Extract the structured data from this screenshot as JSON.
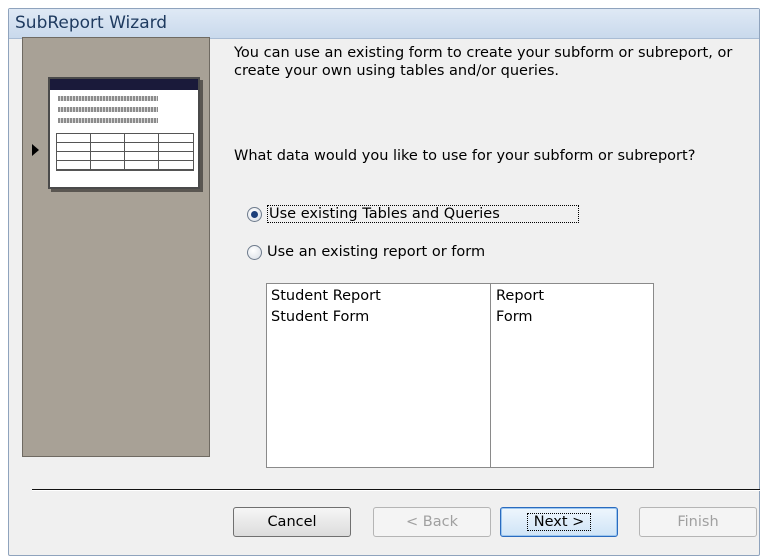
{
  "window": {
    "title": "SubReport Wizard"
  },
  "content": {
    "intro": "You can use an existing form to create your subform or subreport, or create your own using tables and/or queries.",
    "question": "What data would you like to use for your subform or subreport?",
    "options": [
      {
        "label": "Use existing Tables and Queries",
        "checked": true
      },
      {
        "label": "Use an existing report or form",
        "checked": false
      }
    ],
    "list": [
      {
        "name": "Student Report",
        "type": "Report"
      },
      {
        "name": "Student Form",
        "type": "Form"
      }
    ]
  },
  "buttons": {
    "cancel": "Cancel",
    "back": "< Back",
    "next": "Next >",
    "finish": "Finish"
  }
}
